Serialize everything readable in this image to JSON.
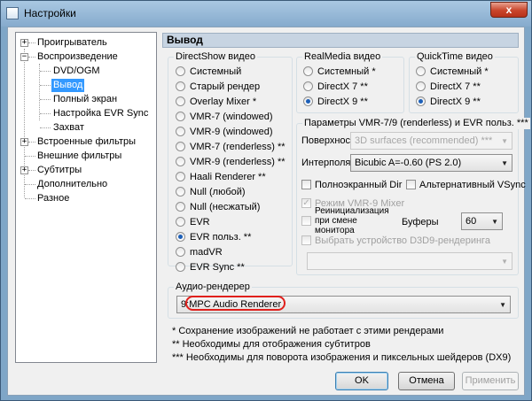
{
  "window": {
    "title": "Настройки",
    "close_label": "x"
  },
  "tree": {
    "expand_minus": "−",
    "expand_plus": "+",
    "items": [
      {
        "label": "Проигрыватель"
      },
      {
        "label": "Воспроизведение"
      },
      {
        "label": "DVD/OGM"
      },
      {
        "label": "Вывод"
      },
      {
        "label": "Полный экран"
      },
      {
        "label": "Настройка EVR Sync"
      },
      {
        "label": "Захват"
      },
      {
        "label": "Встроенные фильтры"
      },
      {
        "label": "Внешние фильтры"
      },
      {
        "label": "Субтитры"
      },
      {
        "label": "Дополнительно"
      },
      {
        "label": "Разное"
      }
    ]
  },
  "page": {
    "title": "Вывод"
  },
  "directshow": {
    "label": "DirectShow видео",
    "options": [
      "Системный",
      "Старый рендер",
      "Overlay Mixer *",
      "VMR-7 (windowed)",
      "VMR-9 (windowed)",
      "VMR-7 (renderless) **",
      "VMR-9 (renderless) **",
      "Haali Renderer **",
      "Null (любой)",
      "Null (несжатый)",
      "EVR",
      "EVR польз. **",
      "madVR",
      "EVR Sync **"
    ],
    "selected_index": 11
  },
  "realmedia": {
    "label": "RealMedia видео",
    "options": [
      "Системный *",
      "DirectX 7 **",
      "DirectX 9 **"
    ],
    "selected_index": 2
  },
  "quicktime": {
    "label": "QuickTime видео",
    "options": [
      "Системный *",
      "DirectX 7 **",
      "DirectX 9 **"
    ],
    "selected_index": 2
  },
  "vmr": {
    "label": "Параметры VMR-7/9 (renderless) и EVR польз. ***",
    "surface_label": "Поверхнос",
    "surface_value": "3D surfaces (recommended) ***",
    "interp_label": "Интерполя",
    "interp_value": "Bicubic A=-0.60 (PS 2.0)",
    "fullscreen_label": "Полноэкранный Dir",
    "alt_vsync_label": "Альтернативный VSync",
    "vmr9_mixer_label": "Режим VMR-9 Mixer",
    "reinit_label": "Реинициализация при смене монитора",
    "buffers_label": "Буферы",
    "buffers_value": "60",
    "d3d9_label": "Выбрать устройство D3D9-рендеринга",
    "check_mark": "✓"
  },
  "audio": {
    "label": "Аудио-рендерер",
    "prefix": "9:",
    "value": "MPC Audio Renderer"
  },
  "notes": [
    "* Сохранение изображений не работает с этими рендерами",
    "** Необходимы для отображения субтитров",
    "*** Необходимы для поворота изображения и пиксельных шейдеров (DX9)"
  ],
  "buttons": {
    "ok": "OK",
    "cancel": "Отмена",
    "apply": "Применить"
  },
  "icons": {
    "dropdown": "chevron-down-icon",
    "close": "close-icon"
  },
  "colors": {
    "selection": "#3399ff",
    "highlight_ring": "#e0201c",
    "title_bar": "#86abcd"
  }
}
